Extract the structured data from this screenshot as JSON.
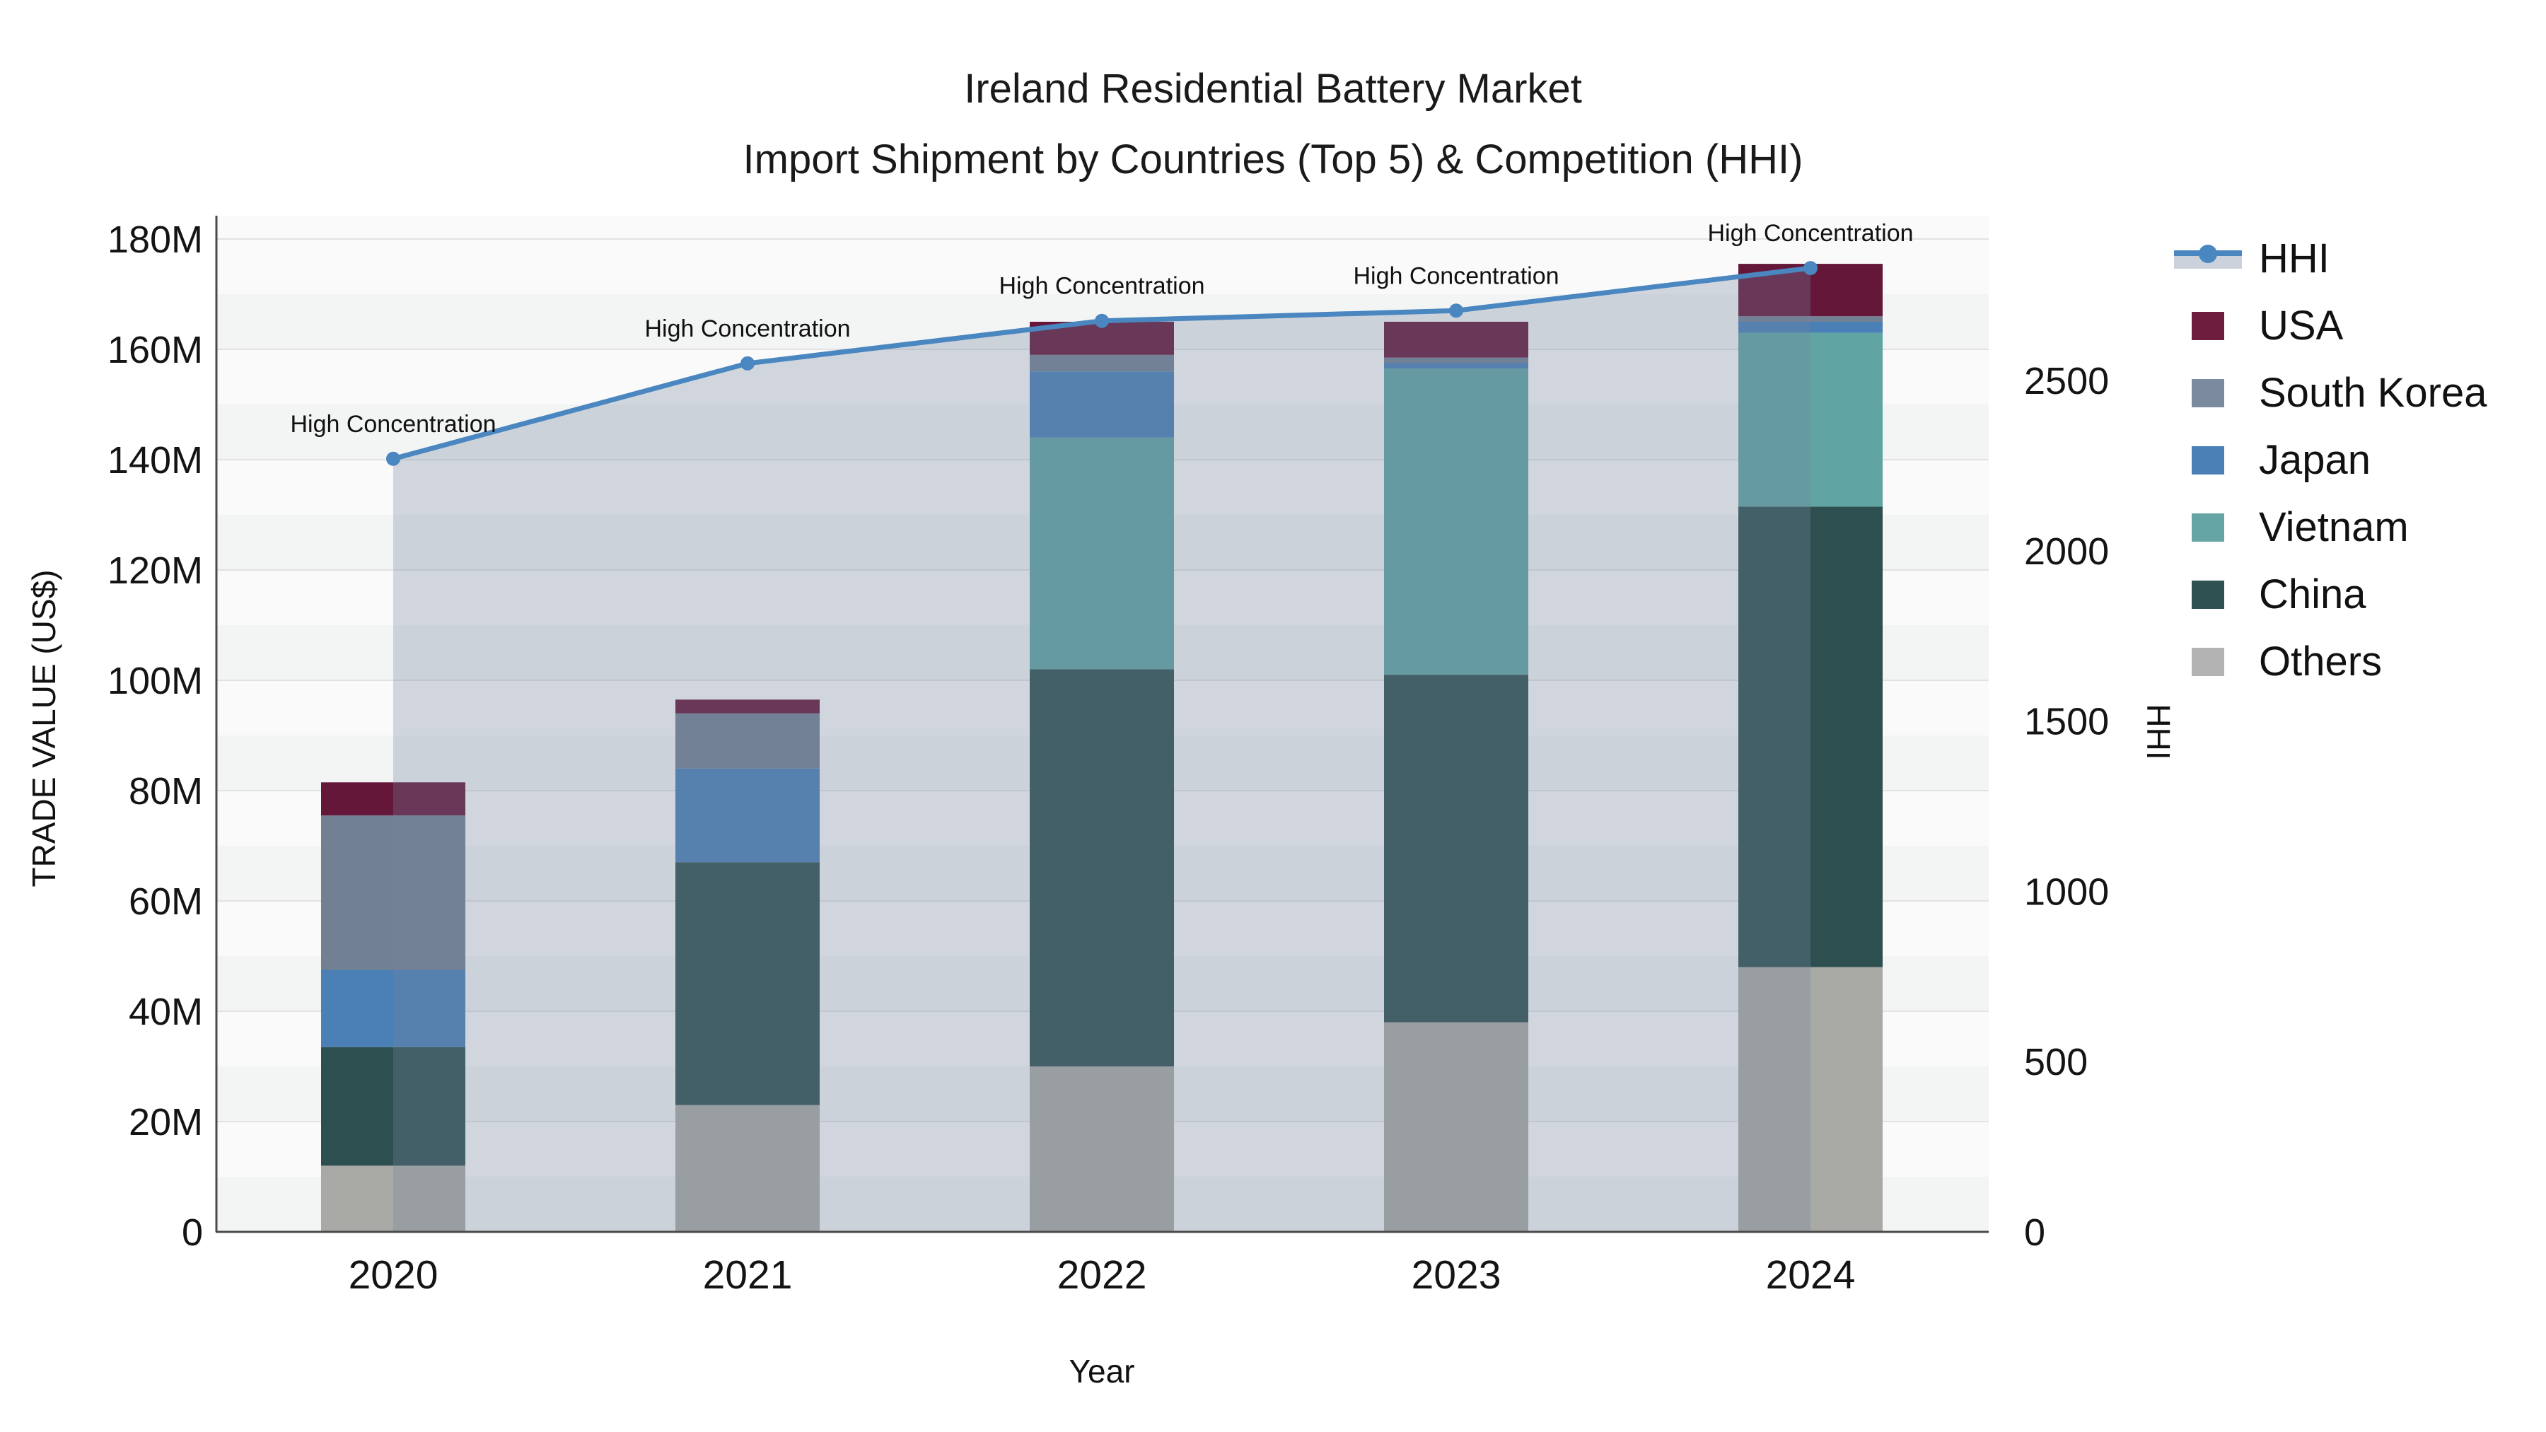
{
  "title": {
    "line1": "Ireland Residential Battery Market",
    "line2": "Import Shipment by Countries (Top 5) & Competition (HHI)"
  },
  "axes": {
    "x": {
      "label": "Year",
      "ticks": [
        "2020",
        "2021",
        "2022",
        "2023",
        "2024"
      ]
    },
    "y_left": {
      "label": "TRADE VALUE (US$)",
      "ticks": [
        "0",
        "20M",
        "40M",
        "60M",
        "80M",
        "100M",
        "120M",
        "140M",
        "160M",
        "180M"
      ]
    },
    "y_right": {
      "label": "HHI",
      "ticks": [
        "0",
        "500",
        "1000",
        "1500",
        "2000",
        "2500"
      ]
    }
  },
  "legend": {
    "items": [
      {
        "label": "HHI",
        "type": "line",
        "color": "#4a86c0"
      },
      {
        "label": "USA",
        "type": "swatch",
        "color": "#6e1d3c"
      },
      {
        "label": "South Korea",
        "type": "swatch",
        "color": "#7b8a9f"
      },
      {
        "label": "Japan",
        "type": "swatch",
        "color": "#4a80b5"
      },
      {
        "label": "Vietnam",
        "type": "swatch",
        "color": "#65a5a5"
      },
      {
        "label": "China",
        "type": "swatch",
        "color": "#2f5151"
      },
      {
        "label": "Others",
        "type": "swatch",
        "color": "#b3b3b3"
      }
    ]
  },
  "annotation_label": "High Concentration",
  "chart_data": {
    "type": "bar",
    "stacked": true,
    "title": "Ireland Residential Battery Market — Import Shipment by Countries (Top 5) & Competition (HHI)",
    "xlabel": "Year",
    "ylabel": "TRADE VALUE (US$)",
    "ylabel_right": "HHI",
    "categories": [
      "2020",
      "2021",
      "2022",
      "2023",
      "2024"
    ],
    "unit": "million US$",
    "series": [
      {
        "name": "Others",
        "color": "#a9a9a5",
        "values": [
          12,
          23,
          30,
          38,
          48
        ]
      },
      {
        "name": "China",
        "color": "#2e4f4f",
        "values": [
          21.5,
          44,
          72,
          63,
          83.5
        ]
      },
      {
        "name": "Vietnam",
        "color": "#61a4a4",
        "values": [
          0,
          0,
          42,
          55.5,
          31.5
        ]
      },
      {
        "name": "Japan",
        "color": "#4a80b5",
        "values": [
          14,
          17,
          12,
          1,
          2
        ]
      },
      {
        "name": "South Korea",
        "color": "#718093",
        "values": [
          28,
          10,
          3,
          1,
          1
        ]
      },
      {
        "name": "USA",
        "color": "#65173a",
        "values": [
          6,
          2.5,
          6,
          6.5,
          9.5
        ]
      }
    ],
    "bar_totals_millions": [
      81.5,
      96.5,
      165,
      165,
      175.5
    ],
    "line_series": {
      "name": "HHI",
      "color": "#4a86c0",
      "axis": "right",
      "values": [
        2270,
        2550,
        2675,
        2705,
        2830
      ],
      "fill_color": "rgba(115,132,160,0.30)",
      "point_annotations": [
        "High Concentration",
        "High Concentration",
        "High Concentration",
        "High Concentration",
        "High Concentration"
      ]
    },
    "ylim_left_millions": [
      0,
      184
    ],
    "ylim_right": [
      0,
      2985
    ],
    "grid": true,
    "legend_position": "right"
  }
}
